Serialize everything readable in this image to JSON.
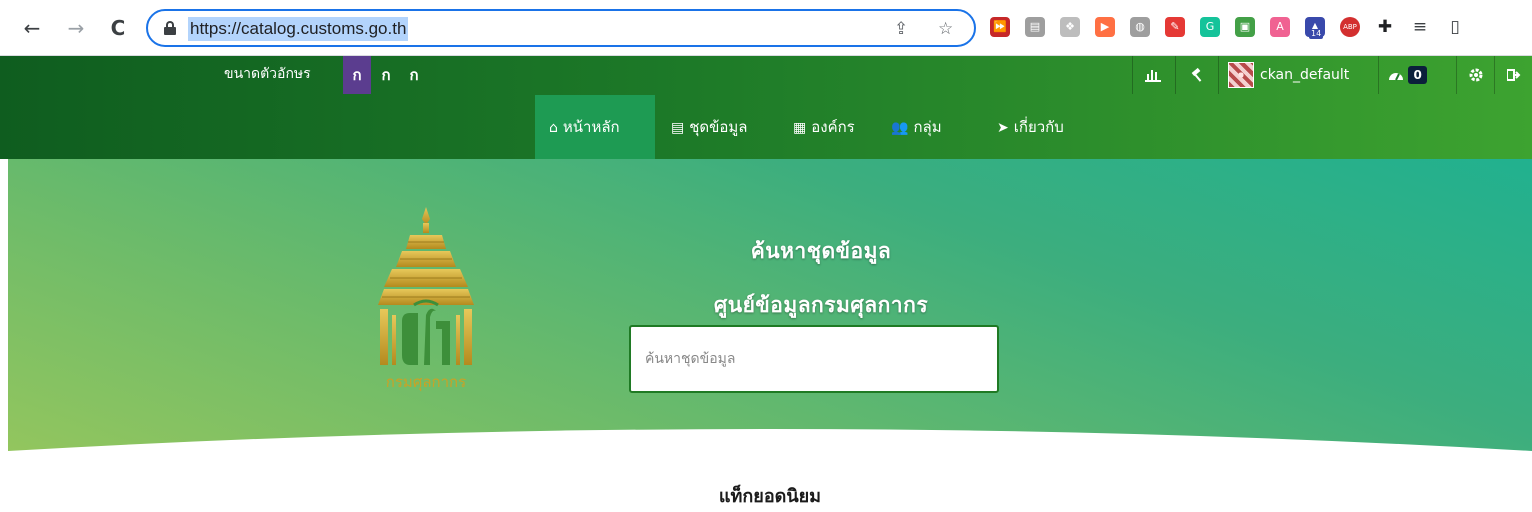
{
  "browser": {
    "url": "https://catalog.customs.go.th",
    "back_icon": "←",
    "forward_icon": "→",
    "reload_icon": "C",
    "share_icon": "⇪",
    "star_icon": "☆",
    "extensions": [
      {
        "name": "fast-forward-ext-icon",
        "glyph": "⏩",
        "color": "#c62828"
      },
      {
        "name": "document-ext-icon",
        "glyph": "▤",
        "color": "#9e9e9e"
      },
      {
        "name": "dropbox-ext-icon",
        "glyph": "❖",
        "color": "#bdbdbd"
      },
      {
        "name": "play-ext-icon",
        "glyph": "▶",
        "color": "#ff7043"
      },
      {
        "name": "globe-ext-icon",
        "glyph": "◍",
        "color": "#9e9e9e"
      },
      {
        "name": "eyedropper-ext-icon",
        "glyph": "✎",
        "color": "#e53935"
      },
      {
        "name": "grammarly-ext-icon",
        "glyph": "G",
        "color": "#15c39a"
      },
      {
        "name": "print-ext-icon",
        "glyph": "▣",
        "color": "#43a047"
      },
      {
        "name": "acrobat-ext-icon",
        "glyph": "A",
        "color": "#f06292"
      },
      {
        "name": "graduation-ext-icon",
        "glyph": "▲",
        "color": "#3949ab"
      },
      {
        "name": "adblock-ext-icon",
        "glyph": "ABP",
        "color": "#d32f2f"
      },
      {
        "name": "puzzle-ext-icon",
        "glyph": "✚",
        "color": "#202124"
      },
      {
        "name": "media-queue-icon",
        "glyph": "≡",
        "color": "#3c4043"
      },
      {
        "name": "side-panel-icon",
        "glyph": "▯",
        "color": "#3c4043"
      }
    ],
    "graduation_badge": "14"
  },
  "topbar": {
    "font_size_label": "ขนาดตัวอักษร",
    "font_options": [
      "ก",
      "ก",
      "ก"
    ],
    "username": "ckan_default",
    "activity_count": "0",
    "stats_icon": "bar-chart-icon",
    "sysadmin_icon": "gavel-icon",
    "dashboard_icon": "tachometer-icon",
    "settings_icon": "cog-icon",
    "logout_icon": "sign-out-icon"
  },
  "nav": {
    "items": [
      {
        "label": "หน้าหลัก",
        "icon": "home-icon",
        "glyph": "⌂",
        "active": true
      },
      {
        "label": "ชุดข้อมูล",
        "icon": "file-icon",
        "glyph": "▤",
        "active": false
      },
      {
        "label": "องค์กร",
        "icon": "building-icon",
        "glyph": "▦",
        "active": false
      },
      {
        "label": "กลุ่ม",
        "icon": "users-icon",
        "glyph": "👥",
        "active": false
      },
      {
        "label": "เกี่ยวกับ",
        "icon": "paper-plane-icon",
        "glyph": "➤",
        "active": false
      }
    ]
  },
  "hero": {
    "title_line1": "ค้นหาชุดข้อมูล",
    "title_line2": "ศูนย์ข้อมูลกรมศุลกากร",
    "search_placeholder": "ค้นหาชุดข้อมูล",
    "logo_caption": "กรมศุลกากร",
    "popular_tags_title": "แท็กยอดนิยม"
  },
  "colors": {
    "header_dark": "#0f5d1f",
    "header_light": "#3da330",
    "nav_active": "#1e9b53",
    "font_active": "#5b3d8f",
    "logo_gold": "#c9a227"
  }
}
